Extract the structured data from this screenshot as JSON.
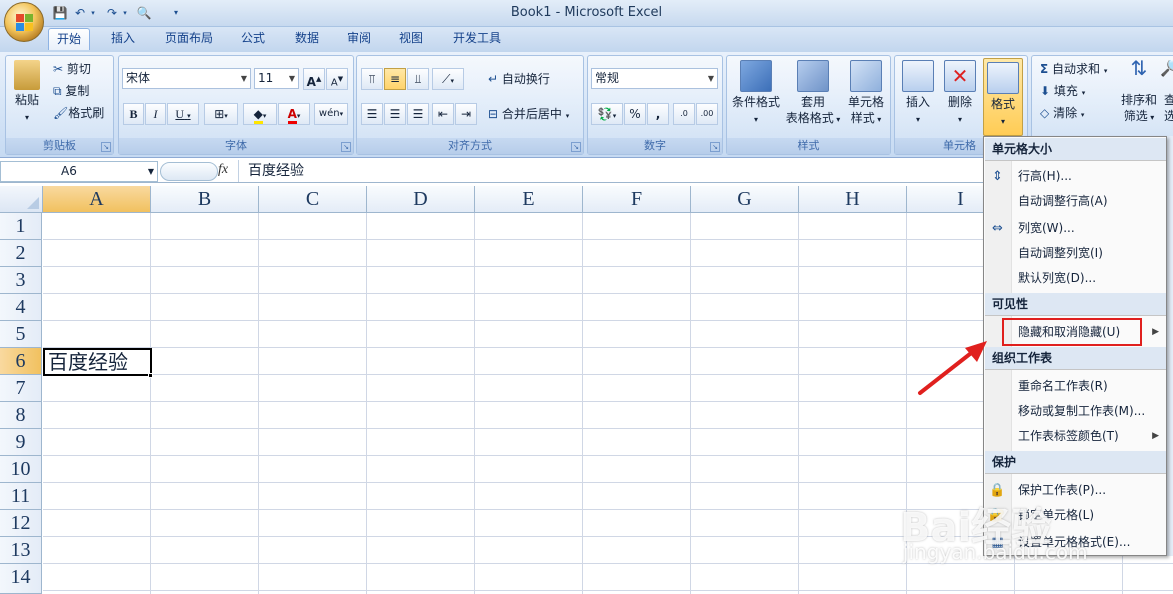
{
  "window": {
    "title": "Book1 - Microsoft Excel"
  },
  "tabs": [
    "开始",
    "插入",
    "页面布局",
    "公式",
    "数据",
    "审阅",
    "视图",
    "开发工具"
  ],
  "clipboard": {
    "paste": "粘贴",
    "cut": "剪切",
    "copy": "复制",
    "format_painter": "格式刷",
    "group": "剪贴板"
  },
  "font": {
    "name": "宋体",
    "size": "11",
    "bold": "B",
    "italic": "I",
    "underline": "U",
    "grow": "A",
    "shrink": "A",
    "phonetic": "wén",
    "group": "字体"
  },
  "alignment": {
    "wrap": "自动换行",
    "merge": "合并后居中",
    "group": "对齐方式"
  },
  "number": {
    "format": "常规",
    "percent": "%",
    "comma": ",",
    "inc_decimal": ".0",
    "dec_decimal": ".00",
    "group": "数字"
  },
  "styles": {
    "conditional": "条件格式",
    "table_line1": "套用",
    "table_line2": "表格格式",
    "cell_line1": "单元格",
    "cell_line2": "样式",
    "group": "样式"
  },
  "cells": {
    "insert": "插入",
    "delete": "删除",
    "format": "格式",
    "group": "单元格"
  },
  "editing": {
    "autosum": "自动求和",
    "fill": "填充",
    "clear": "清除",
    "sort_line1": "排序和",
    "sort_line2": "筛选",
    "find_line1": "查",
    "find_line2": "选"
  },
  "formula_bar": {
    "name_box": "A6",
    "fx": "fx",
    "content": "百度经验"
  },
  "columns": [
    "A",
    "B",
    "C",
    "D",
    "E",
    "F",
    "G",
    "H",
    "I"
  ],
  "rows": [
    "1",
    "2",
    "3",
    "4",
    "5",
    "6",
    "7",
    "8",
    "9",
    "10",
    "11",
    "12",
    "13",
    "14"
  ],
  "active_cell": {
    "ref": "A6",
    "value": "百度经验"
  },
  "format_menu": {
    "cell_size": {
      "header": "单元格大小",
      "row_height": "行高(H)...",
      "autofit_row": "自动调整行高(A)",
      "col_width": "列宽(W)...",
      "autofit_col": "自动调整列宽(I)",
      "default_width": "默认列宽(D)..."
    },
    "visibility": {
      "header": "可见性",
      "hide_unhide": "隐藏和取消隐藏(U)"
    },
    "organize": {
      "header": "组织工作表",
      "rename": "重命名工作表(R)",
      "move_copy": "移动或复制工作表(M)...",
      "tab_color": "工作表标签颜色(T)"
    },
    "protection": {
      "header": "保护",
      "protect_sheet": "保护工作表(P)...",
      "lock_cell": "锁定单元格(L)",
      "format_cells": "设置单元格格式(E)..."
    }
  },
  "watermark": {
    "logo": "Bai经验",
    "url": "jingyan.baidu.com"
  },
  "colors": {
    "highlight": "#e0201e",
    "selected_header": "#f1c15f"
  }
}
